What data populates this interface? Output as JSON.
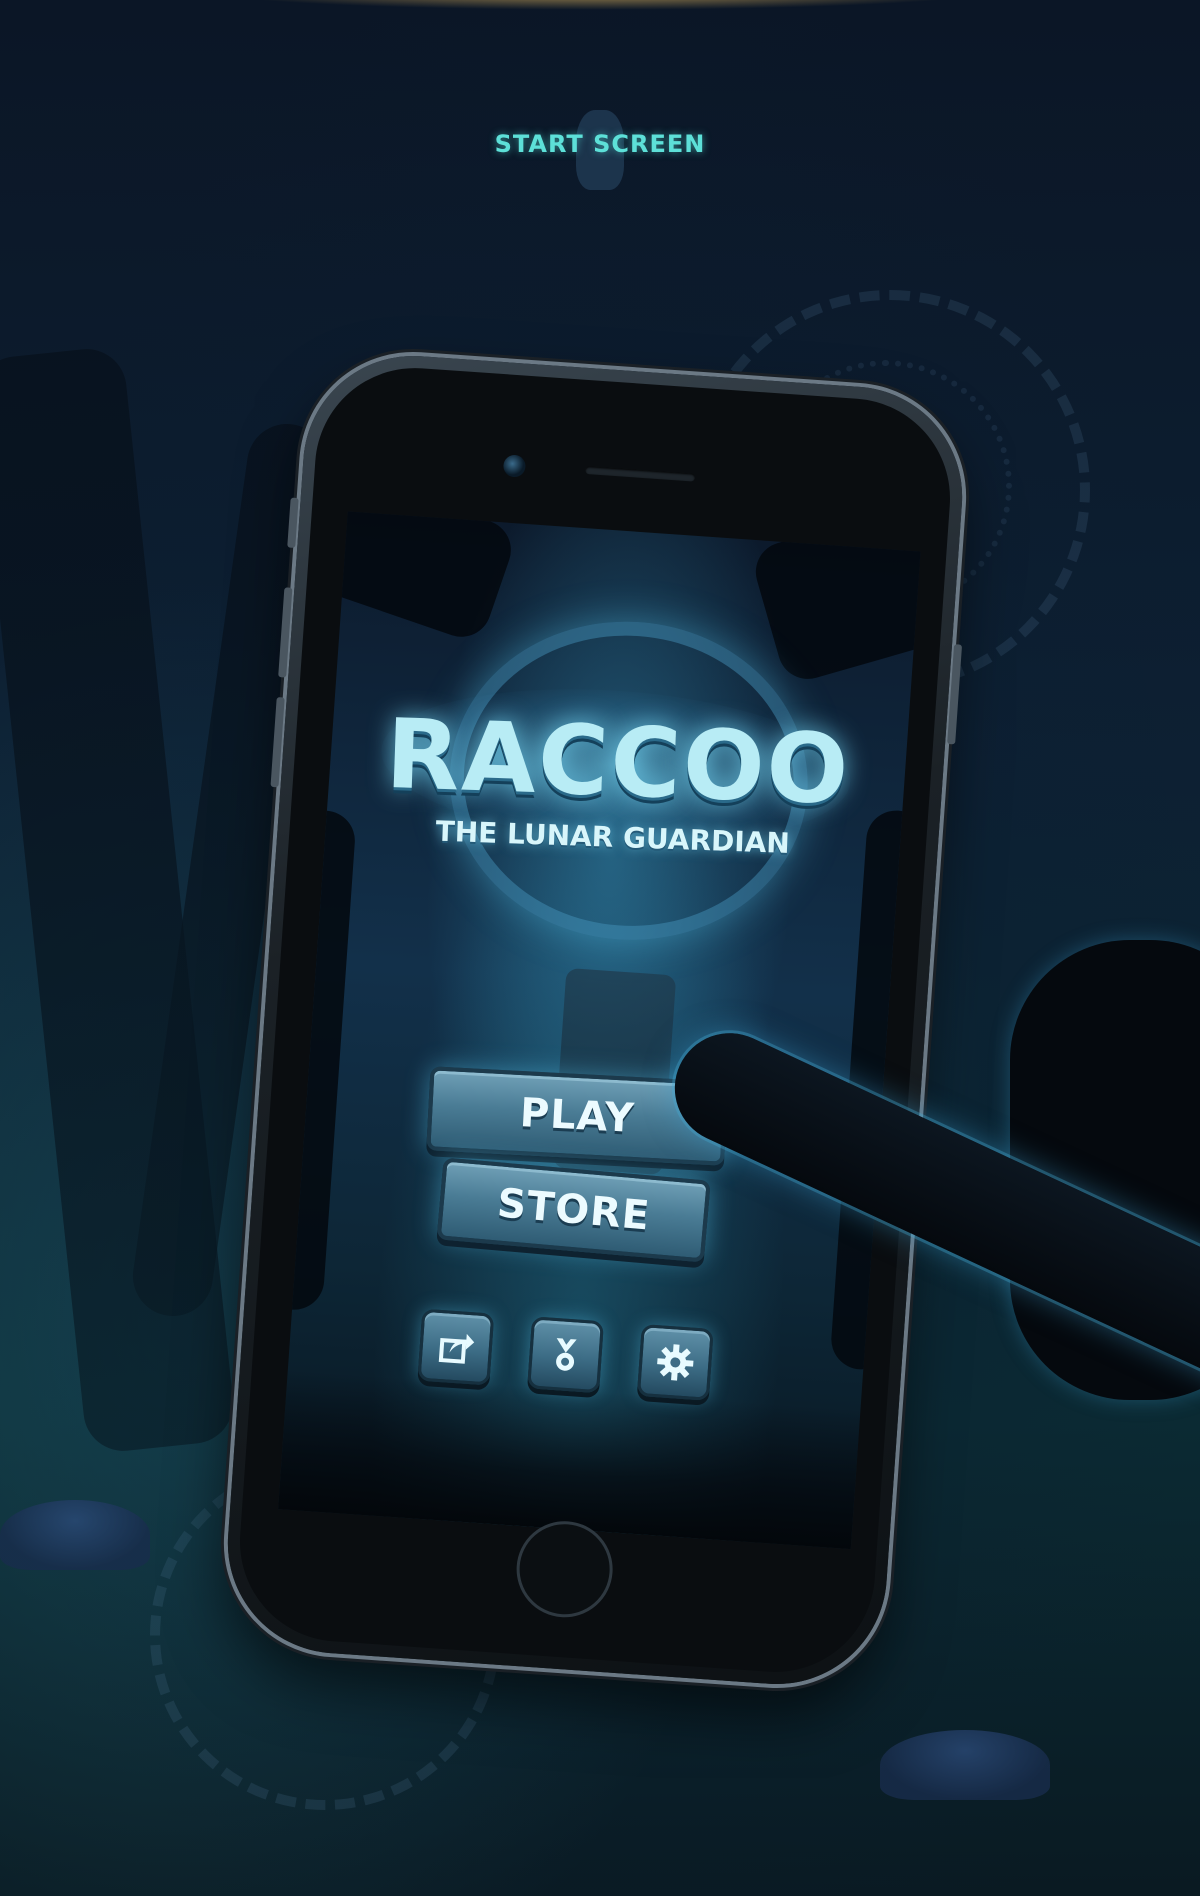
{
  "header": {
    "title": "START SCREEN"
  },
  "game": {
    "title": "RACCOO",
    "subtitle": "THE LUNAR GUARDIAN"
  },
  "menu": {
    "play_label": "PLAY",
    "store_label": "STORE"
  },
  "icons": {
    "share": "share-icon",
    "achievements": "medal-icon",
    "settings": "gear-icon"
  },
  "colors": {
    "accent": "#5de0d8",
    "button": "#4a7c95",
    "background": "#0b1626"
  }
}
